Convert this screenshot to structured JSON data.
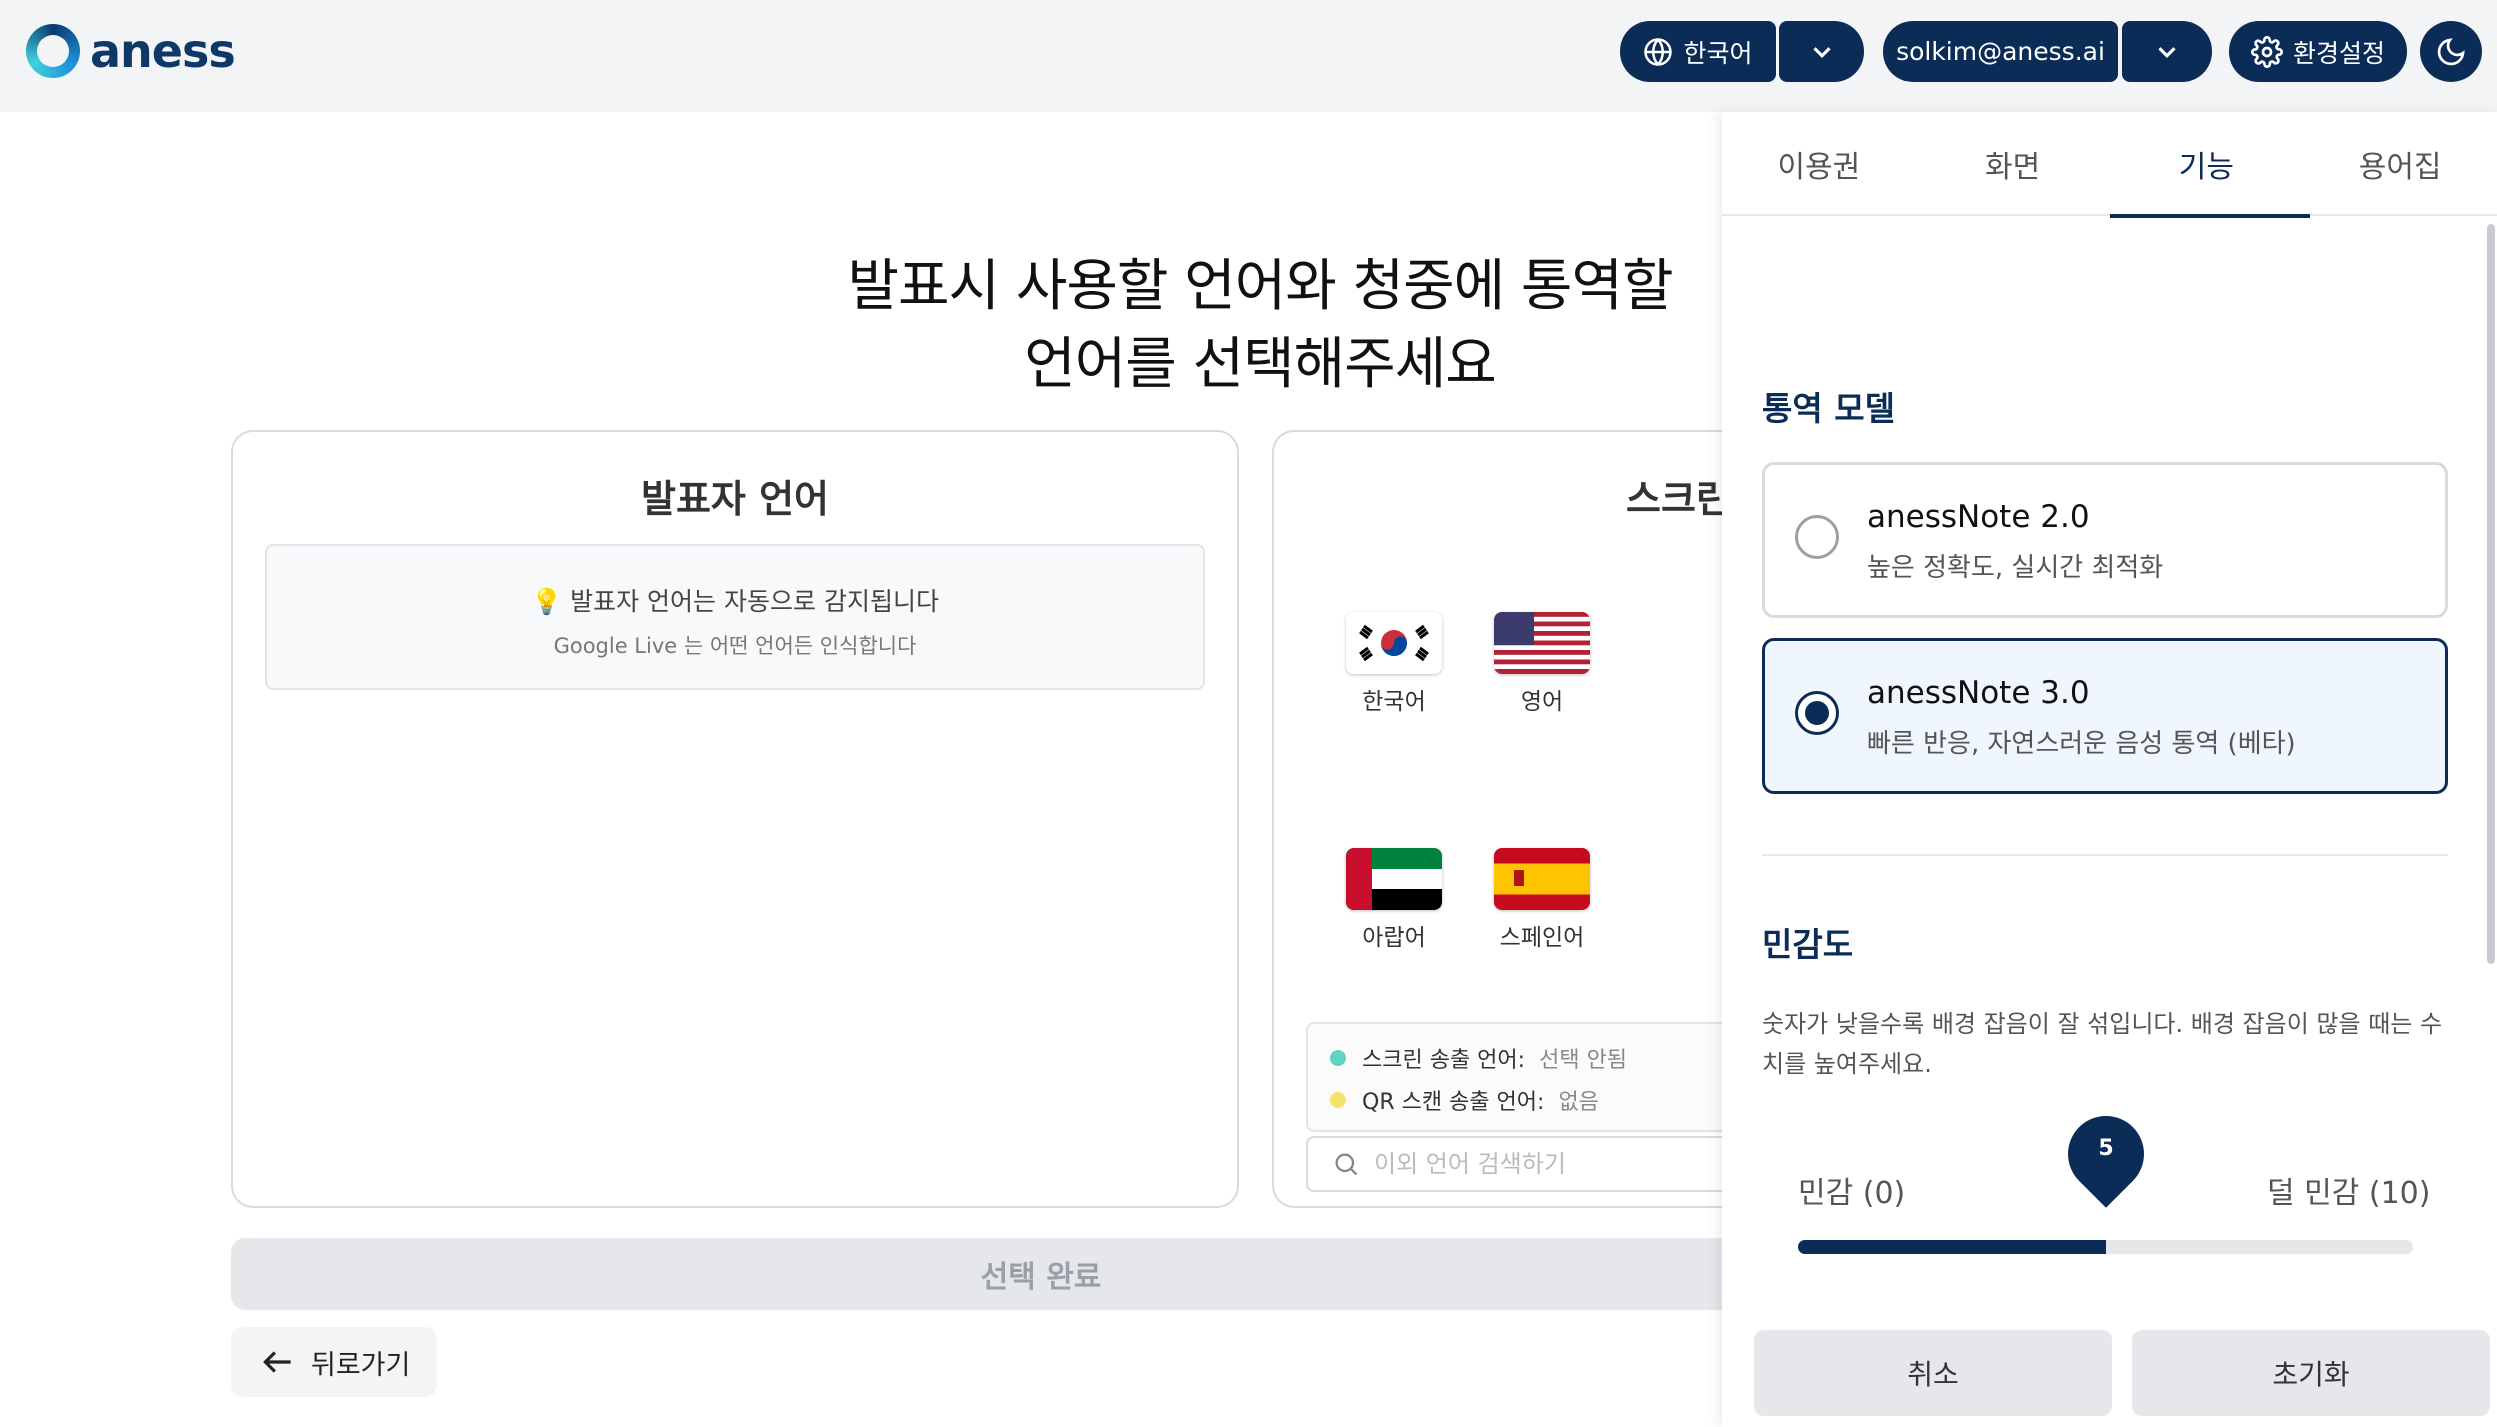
{
  "brand": {
    "name": "aness"
  },
  "header": {
    "language_label": "한국어",
    "user_email": "solkim@aness.ai",
    "settings_label": "환경설정"
  },
  "main": {
    "title_line1": "발표시 사용할 언어와 청중에 통역할",
    "title_line2": "언어를 선택해주세요",
    "speaker_card": {
      "title": "발표자 언어",
      "info_main": "💡 발표자 언어는 자동으로 감지됩니다",
      "info_sub": "Google Live 는 어떤 언어든 인식합니다"
    },
    "screen_card": {
      "title": "스크린",
      "languages": [
        {
          "label": "한국어",
          "flag": "korea-flag"
        },
        {
          "label": "영어",
          "flag": "usa-flag"
        },
        {
          "label": "아랍어",
          "flag": "uae-flag"
        },
        {
          "label": "스페인어",
          "flag": "spain-flag"
        }
      ],
      "status": [
        {
          "key": "스크린 송출 언어:",
          "value": "선택 안됨",
          "color": "#5fd3c4"
        },
        {
          "key": "QR 스캔 송출 언어:",
          "value": "없음",
          "color": "#f7e26b"
        }
      ],
      "search_placeholder": "이외 언어 검색하기"
    },
    "complete_label": "선택 완료",
    "back_label": "뒤로가기"
  },
  "panel": {
    "tabs": [
      {
        "label": "이용권",
        "active": false
      },
      {
        "label": "화면",
        "active": false
      },
      {
        "label": "기능",
        "active": true
      },
      {
        "label": "용어집",
        "active": false
      }
    ],
    "model_section_title": "통역 모델",
    "models": [
      {
        "name": "anessNote 2.0",
        "desc": "높은 정확도, 실시간 최적화",
        "selected": false
      },
      {
        "name": "anessNote 3.0",
        "desc": "빠른 반응, 자연스러운 음성 통역 (베타)",
        "selected": true
      }
    ],
    "sensitivity": {
      "title": "민감도",
      "desc": "숫자가 낮을수록 배경 잡음이 잘 섞입니다. 배경 잡음이 많을 때는 수치를 높여주세요.",
      "low_label": "민감 (0)",
      "high_label": "덜 민감 (10)",
      "value": 5,
      "value_text": "5",
      "min": 0,
      "max": 10
    },
    "cancel_label": "취소",
    "reset_label": "초기화"
  },
  "colors": {
    "primary": "#0b2c57",
    "header_bg": "#f3f4f6"
  }
}
